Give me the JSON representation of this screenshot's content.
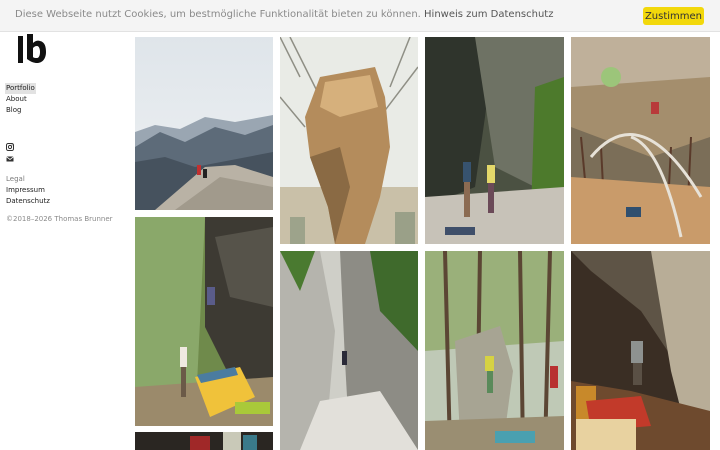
{
  "cookie": {
    "text": "Diese Webseite nutzt Cookies, um bestmögliche Funktionalität bieten zu können.",
    "link": "Hinweis zum Datenschutz",
    "accept": "Zustimmen"
  },
  "nav": {
    "portfolio": "Portfolio",
    "about": "About",
    "blog": "Blog"
  },
  "social": [
    "instagram-icon",
    "email-icon"
  ],
  "legal": {
    "title": "Legal",
    "impressum": "Impressum",
    "datenschutz": "Datenschutz"
  },
  "copyright": "©2018–2026 Thomas Brunner",
  "colors": {
    "accent": "#f2d80b",
    "active_nav_bg": "#e2e2e2"
  },
  "gallery": [
    "photo-mountain-summit-climbers",
    "photo-balanced-boulder-tower",
    "photo-two-climbers-at-rock-wall",
    "photo-climber-on-overhang-autumn",
    "photo-forest-boulder-with-crashpads",
    "photo-climber-in-gorge",
    "photo-climber-on-boulder-in-forest",
    "photo-climber-under-roof",
    "photo-climber-partial-bottom"
  ]
}
